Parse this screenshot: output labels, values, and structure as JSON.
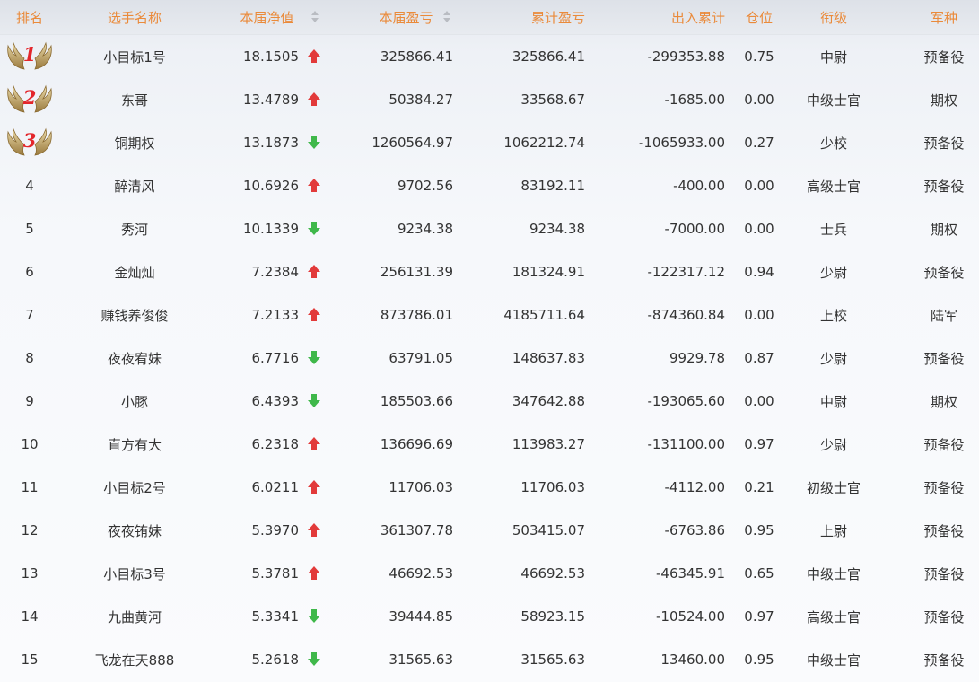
{
  "header": {
    "rank": "排名",
    "name": "选手名称",
    "nav": "本届净值",
    "profit": "本届盈亏",
    "cumulative": "累计盈亏",
    "flow": "出入累计",
    "position": "仓位",
    "rank_title": "衔级",
    "army": "军种"
  },
  "icons": {
    "medal": "winged-medal-icon",
    "up": "red-up-arrow-icon",
    "down": "green-down-arrow-icon",
    "sort": "sort-icon"
  },
  "colors": {
    "header_text": "#ea8a3a",
    "up": "#e23a3a",
    "down": "#3fb84a",
    "medal_num": "#e3262b"
  },
  "rows": [
    {
      "rank": "1",
      "name": "小目标1号",
      "nav": "18.1505",
      "trend": "up",
      "profit": "325866.41",
      "cumulative": "325866.41",
      "flow": "-299353.88",
      "position": "0.75",
      "rank_title": "中尉",
      "army": "预备役"
    },
    {
      "rank": "2",
      "name": "东哥",
      "nav": "13.4789",
      "trend": "up",
      "profit": "50384.27",
      "cumulative": "33568.67",
      "flow": "-1685.00",
      "position": "0.00",
      "rank_title": "中级士官",
      "army": "期权"
    },
    {
      "rank": "3",
      "name": "铜期权",
      "nav": "13.1873",
      "trend": "down",
      "profit": "1260564.97",
      "cumulative": "1062212.74",
      "flow": "-1065933.00",
      "position": "0.27",
      "rank_title": "少校",
      "army": "预备役"
    },
    {
      "rank": "4",
      "name": "醉清风",
      "nav": "10.6926",
      "trend": "up",
      "profit": "9702.56",
      "cumulative": "83192.11",
      "flow": "-400.00",
      "position": "0.00",
      "rank_title": "高级士官",
      "army": "预备役"
    },
    {
      "rank": "5",
      "name": "秀河",
      "nav": "10.1339",
      "trend": "down",
      "profit": "9234.38",
      "cumulative": "9234.38",
      "flow": "-7000.00",
      "position": "0.00",
      "rank_title": "士兵",
      "army": "期权"
    },
    {
      "rank": "6",
      "name": "金灿灿",
      "nav": "7.2384",
      "trend": "up",
      "profit": "256131.39",
      "cumulative": "181324.91",
      "flow": "-122317.12",
      "position": "0.94",
      "rank_title": "少尉",
      "army": "预备役"
    },
    {
      "rank": "7",
      "name": "赚钱养俊俊",
      "nav": "7.2133",
      "trend": "up",
      "profit": "873786.01",
      "cumulative": "4185711.64",
      "flow": "-874360.84",
      "position": "0.00",
      "rank_title": "上校",
      "army": "陆军"
    },
    {
      "rank": "8",
      "name": "夜夜宥妹",
      "nav": "6.7716",
      "trend": "down",
      "profit": "63791.05",
      "cumulative": "148637.83",
      "flow": "9929.78",
      "position": "0.87",
      "rank_title": "少尉",
      "army": "预备役"
    },
    {
      "rank": "9",
      "name": "小豚",
      "nav": "6.4393",
      "trend": "down",
      "profit": "185503.66",
      "cumulative": "347642.88",
      "flow": "-193065.60",
      "position": "0.00",
      "rank_title": "中尉",
      "army": "期权"
    },
    {
      "rank": "10",
      "name": "直方有大",
      "nav": "6.2318",
      "trend": "up",
      "profit": "136696.69",
      "cumulative": "113983.27",
      "flow": "-131100.00",
      "position": "0.97",
      "rank_title": "少尉",
      "army": "预备役"
    },
    {
      "rank": "11",
      "name": "小目标2号",
      "nav": "6.0211",
      "trend": "up",
      "profit": "11706.03",
      "cumulative": "11706.03",
      "flow": "-4112.00",
      "position": "0.21",
      "rank_title": "初级士官",
      "army": "预备役"
    },
    {
      "rank": "12",
      "name": "夜夜铕妹",
      "nav": "5.3970",
      "trend": "up",
      "profit": "361307.78",
      "cumulative": "503415.07",
      "flow": "-6763.86",
      "position": "0.95",
      "rank_title": "上尉",
      "army": "预备役"
    },
    {
      "rank": "13",
      "name": "小目标3号",
      "nav": "5.3781",
      "trend": "up",
      "profit": "46692.53",
      "cumulative": "46692.53",
      "flow": "-46345.91",
      "position": "0.65",
      "rank_title": "中级士官",
      "army": "预备役"
    },
    {
      "rank": "14",
      "name": "九曲黄河",
      "nav": "5.3341",
      "trend": "down",
      "profit": "39444.85",
      "cumulative": "58923.15",
      "flow": "-10524.00",
      "position": "0.97",
      "rank_title": "高级士官",
      "army": "预备役"
    },
    {
      "rank": "15",
      "name": "飞龙在天888",
      "nav": "5.2618",
      "trend": "down",
      "profit": "31565.63",
      "cumulative": "31565.63",
      "flow": "13460.00",
      "position": "0.95",
      "rank_title": "中级士官",
      "army": "预备役"
    }
  ]
}
